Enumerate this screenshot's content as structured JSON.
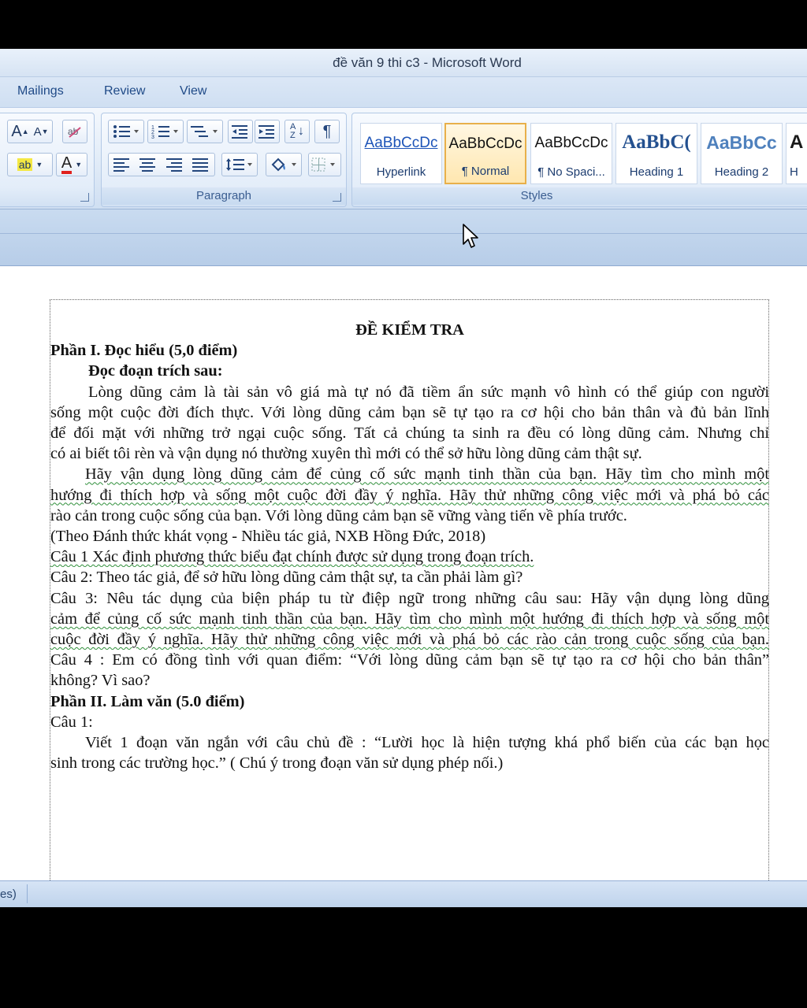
{
  "window": {
    "title": "đề văn 9 thi c3 - Microsoft Word"
  },
  "tabs": [
    {
      "label": "Mailings"
    },
    {
      "label": "Review"
    },
    {
      "label": "View"
    }
  ],
  "ribbon": {
    "font_group": {
      "grow_label": "A",
      "shrink_label": "A",
      "highlight_label": "ab",
      "font_color_label": "A"
    },
    "paragraph_group": {
      "label": "Paragraph",
      "pilcrow": "¶",
      "sort_label": "AZ"
    },
    "styles_group": {
      "label": "Styles",
      "items": [
        {
          "sample": "AaBbCcDc",
          "name": "Hyperlink"
        },
        {
          "sample": "AaBbCcDc",
          "name": "¶ Normal"
        },
        {
          "sample": "AaBbCcDc",
          "name": "¶ No Spaci..."
        },
        {
          "sample": "AaBbC(",
          "name": "Heading 1"
        },
        {
          "sample": "AaBbCc",
          "name": "Heading 2"
        },
        {
          "sample": "A",
          "name": "H"
        }
      ]
    }
  },
  "document": {
    "lines": [
      "ĐỀ KIỂM TRA",
      "Phần I. Đọc hiểu (5,0 điểm)",
      "Đọc đoạn trích sau:",
      "Lòng dũng cảm là tài sản vô giá mà tự nó đã tiềm ẩn sức mạnh vô hình có thể giúp con người",
      "sống một cuộc đời đích thực. Với lòng dũng cảm bạn sẽ tự tạo ra cơ hội cho bản thân và đủ bản lĩnh",
      "để đối mặt với những trở ngại cuộc sống. Tất cả chúng ta sinh ra đều có lòng dũng cảm. Nhưng chỉ",
      "có ai biết tôi rèn và vận dụng nó thường xuyên thì mới có thể sở hữu lòng dũng cảm thật sự.",
      "Hãy vận dụng lòng dũng cảm để củng cố sức mạnh tinh thần của bạn. Hãy tìm cho mình một",
      "hướng đi thích hợp và sống một cuộc đời đầy ý nghĩa. Hãy thử những công việc mới và phá bỏ các",
      "rào cản trong cuộc sống của bạn. Với lòng dũng cảm bạn sẽ vững vàng tiến về phía trước.",
      "(Theo Đánh thức khát vọng - Nhiều tác giả, NXB Hồng Đức, 2018)",
      "Câu 1 Xác định phương thức biểu đạt chính được sử dụng trong đoạn trích.",
      "Câu 2: Theo tác giả, để sở hữu lòng dũng cảm thật sự, ta cần phải làm gì?",
      "Câu 3: Nêu tác dụng của biện pháp tu từ điệp ngữ trong những câu sau: Hãy vận dụng lòng dũng",
      "cảm để củng cố sức mạnh tinh thần của bạn. Hãy tìm cho mình một hướng đi thích hợp và sống một",
      "cuộc đời đầy ý nghĩa. Hãy thử những công việc mới và phá bỏ các rào cản trong cuộc sống của bạn.",
      "Câu 4 : Em có đồng tình với quan điểm: “Với lòng dũng cảm bạn sẽ tự tạo ra cơ hội cho bản thân”",
      "không? Vì sao?",
      "Phần II. Làm văn (5.0 điểm)",
      "Câu 1:",
      "Viết 1 đoạn văn ngắn với câu chủ đề : “Lười học là hiện tượng khá phổ biến của các bạn học",
      "sinh trong các trường học.” ( Chú ý trong đoạn văn sử dụng phép nối.)"
    ]
  },
  "statusbar": {
    "text": "es)"
  },
  "colors": {
    "ribbon_blue": "#dfe9f5",
    "selected_style": "#ffe7b0",
    "tab_text": "#1f4a87"
  }
}
